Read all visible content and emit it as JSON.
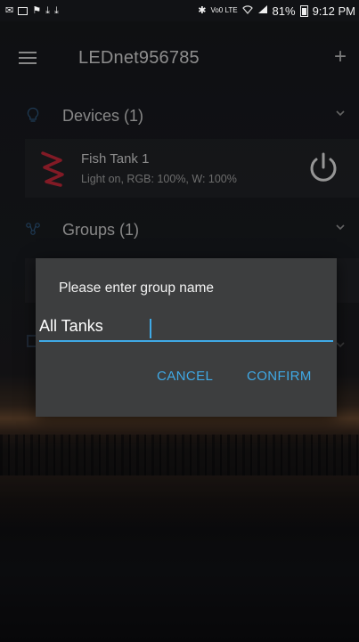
{
  "status_bar": {
    "battery_percent": "81%",
    "time": "9:12 PM",
    "left_icons": [
      "mail-icon",
      "image-icon",
      "flag-icon",
      "download-icon",
      "download-icon"
    ],
    "right_icons": [
      "bluetooth-icon",
      "volte-icon",
      "wifi-icon",
      "signal-icon",
      "battery-icon"
    ],
    "volte_label": "Vo0 LTE"
  },
  "app_bar": {
    "title": "LEDnet956785",
    "menu_icon": "hamburger-menu-icon",
    "add_icon": "plus-icon"
  },
  "devices_section": {
    "title": "Devices (1)",
    "icon": "lightbulb-icon",
    "items": [
      {
        "name": "Fish Tank 1",
        "status": "Light on, RGB: 100%, W: 100%",
        "icon": "led-strip-icon",
        "power_icon": "power-icon"
      }
    ]
  },
  "groups_section": {
    "title": "Groups (1)",
    "icon": "group-nodes-icon"
  },
  "dialog": {
    "title": "Please enter group name",
    "input_value": "All Tanks",
    "cancel_label": "CANCEL",
    "confirm_label": "CONFIRM"
  },
  "colors": {
    "accent": "#3fa9e6",
    "dialog_bg": "#3d3e3f",
    "strip_red": "#c8283a"
  }
}
